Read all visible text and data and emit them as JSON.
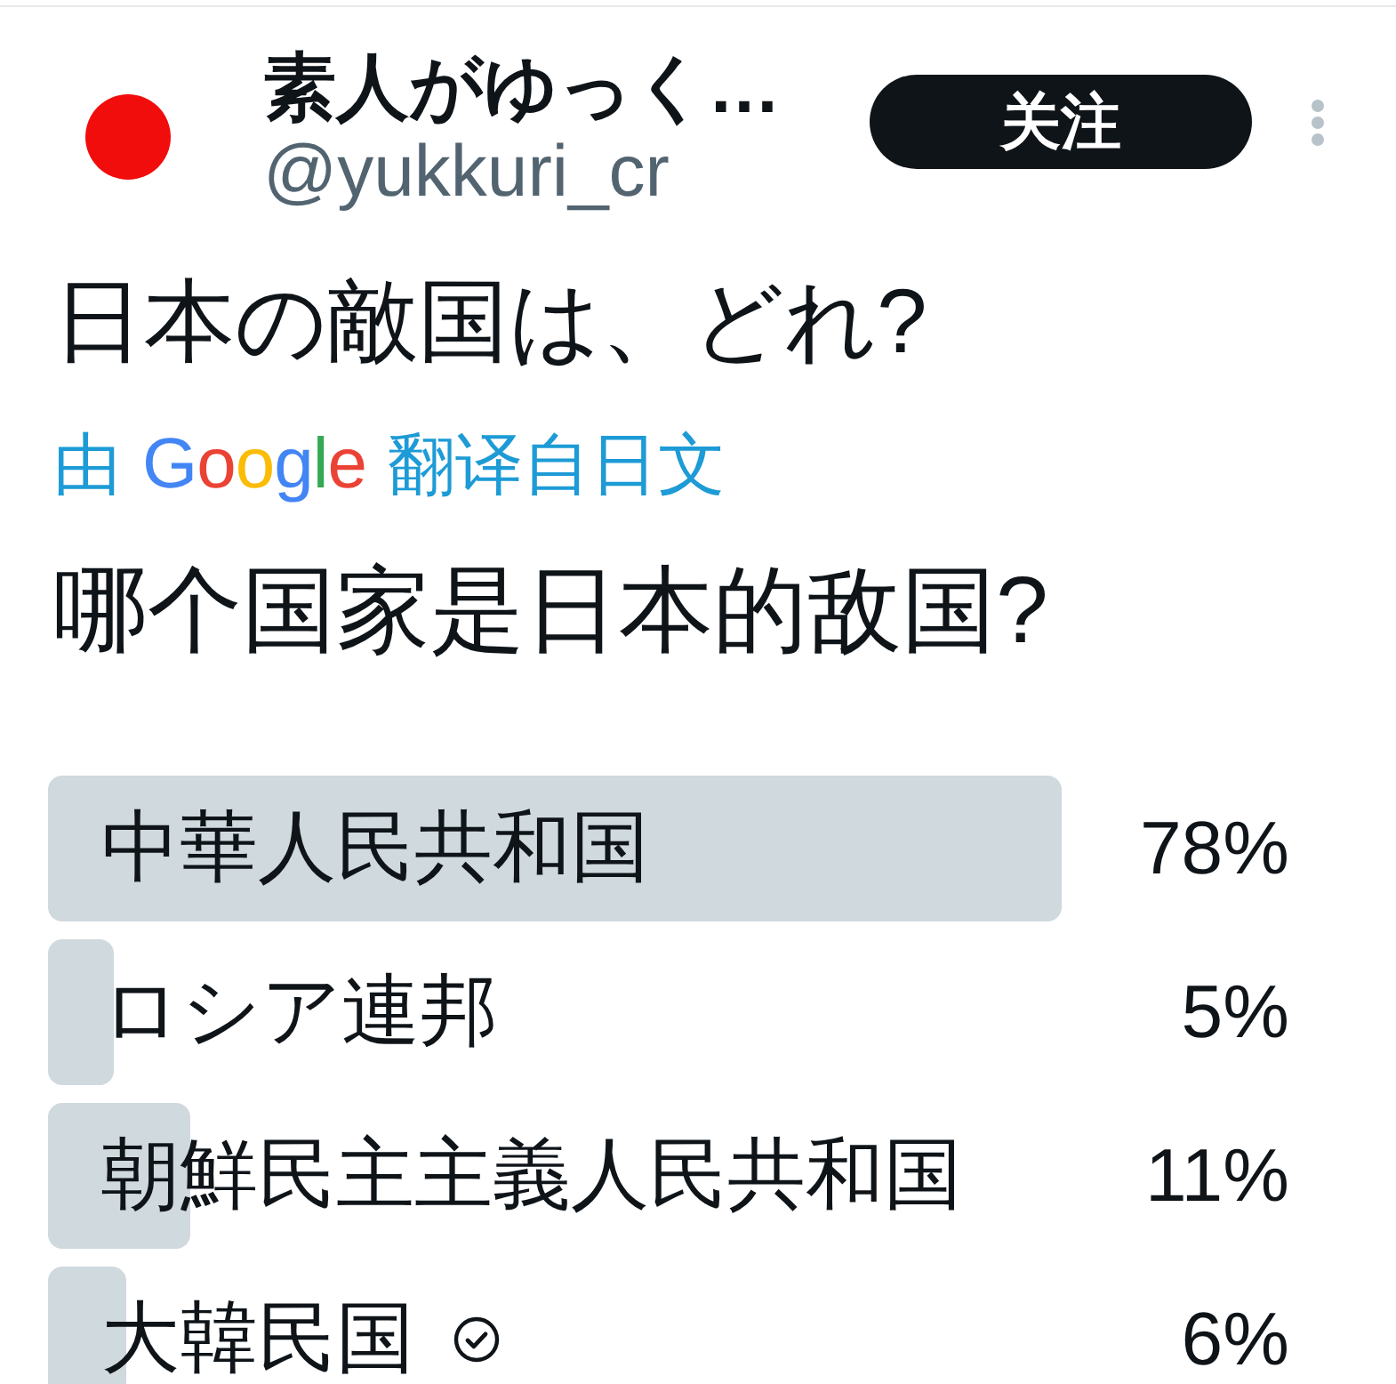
{
  "author": {
    "name": "素人がゆっく…",
    "handle": "@yukkuri_cr"
  },
  "follow_button": {
    "label": "关注"
  },
  "tweet": {
    "text": "日本の敵国は、どれ?",
    "translation_note": {
      "prefix": "由",
      "logo": "Google",
      "suffix": "翻译自日文"
    },
    "translated_text": "哪个国家是日本的敌国?"
  },
  "poll": {
    "options": [
      {
        "label": "中華人民共和国",
        "percent": "78%",
        "level": 0.78,
        "voted": false
      },
      {
        "label": "ロシア連邦",
        "percent": "5%",
        "level": 0.05,
        "voted": false
      },
      {
        "label": "朝鮮民主主義人民共和国",
        "percent": "11%",
        "level": 0.11,
        "voted": false
      },
      {
        "label": "大韓民国",
        "percent": "6%",
        "level": 0.06,
        "voted": true
      }
    ]
  }
}
